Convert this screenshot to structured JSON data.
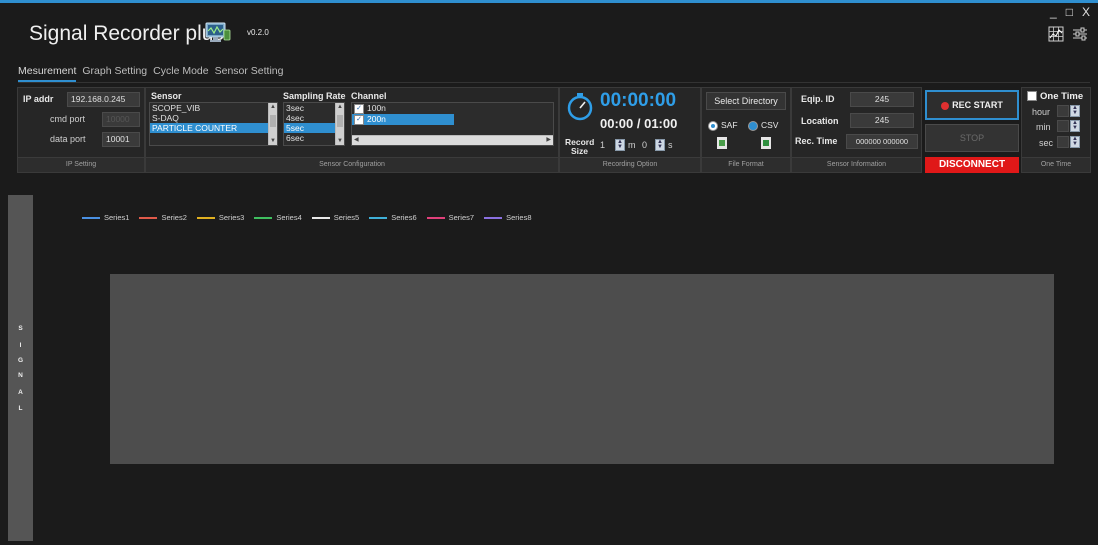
{
  "app": {
    "title": "Signal Recorder plus",
    "version": "v0.2.0"
  },
  "window_controls": {
    "minimize": "_",
    "maximize": "□",
    "close": "X"
  },
  "tabs": [
    {
      "label": "Mesurement",
      "active": true
    },
    {
      "label": "Graph Setting",
      "active": false
    },
    {
      "label": "Cycle Mode",
      "active": false
    },
    {
      "label": "Sensor Setting",
      "active": false
    }
  ],
  "ip_setting": {
    "ip_label": "IP addr",
    "ip_value": "192.168.0.245",
    "cmd_label": "cmd port",
    "cmd_value": "10000",
    "data_label": "data port",
    "data_value": "10001",
    "footer": "IP Setting"
  },
  "sensor_config": {
    "sensor_header": "Sensor",
    "sensors": [
      "SCOPE_VIB",
      "S-DAQ",
      "PARTICLE COUNTER"
    ],
    "sensor_selected": 2,
    "rate_header": "Sampling Rate",
    "rates": [
      "3sec",
      "4sec",
      "5sec",
      "6sec"
    ],
    "rate_selected": 2,
    "channel_header": "Channel",
    "channels": [
      {
        "label": "100n",
        "checked": true
      },
      {
        "label": "200n",
        "checked": true
      }
    ],
    "channel_selected": 1,
    "footer": "Sensor Configuration"
  },
  "recording": {
    "elapsed": "00:00:00",
    "progress": "00:00 / 01:00",
    "record_label_1": "Record",
    "record_label_2": "Size",
    "minutes": "1",
    "m_unit": "m",
    "seconds": "0",
    "s_unit": "s",
    "footer": "Recording Option"
  },
  "file_format": {
    "select_dir": "Select Directory",
    "saf": "SAF",
    "csv": "CSV",
    "selected": "SAF",
    "footer": "File Format"
  },
  "sensor_info": {
    "eqip_label": "Eqip. ID",
    "eqip_value": "245",
    "location_label": "Location",
    "location_value": "245",
    "rec_label": "Rec. Time",
    "rec_value": "000000 000000",
    "footer": "Sensor Information"
  },
  "controls": {
    "rec_start": "REC START",
    "stop": "STOP",
    "status": "DISCONNECT"
  },
  "one_time": {
    "label": "One Time",
    "checked": false,
    "hour": "hour",
    "min": "min",
    "sec": "sec",
    "footer": "One Time"
  },
  "signal_label": [
    "S",
    "I",
    "G",
    "N",
    "A",
    "L"
  ],
  "legend": [
    {
      "name": "Series1",
      "color": "#4a90e2"
    },
    {
      "name": "Series2",
      "color": "#e05a4a"
    },
    {
      "name": "Series3",
      "color": "#e0b020"
    },
    {
      "name": "Series4",
      "color": "#3fbf5f"
    },
    {
      "name": "Series5",
      "color": "#e8e8e8"
    },
    {
      "name": "Series6",
      "color": "#3fb0d8"
    },
    {
      "name": "Series7",
      "color": "#e0407a"
    },
    {
      "name": "Series8",
      "color": "#8a70e0"
    }
  ],
  "colors": {
    "accent": "#2f8fd0",
    "status_red": "#e01818",
    "time_blue": "#2f9ee8"
  }
}
